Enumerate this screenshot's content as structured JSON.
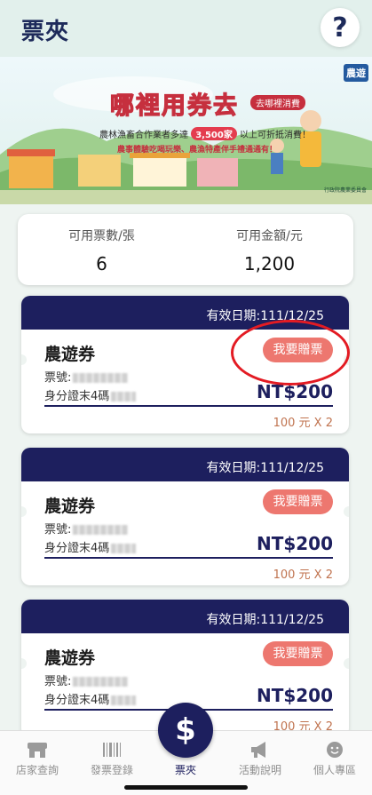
{
  "header": {
    "title": "票夾",
    "help_icon": "question-icon"
  },
  "banner": {
    "title": "哪裡用券去",
    "tag": "去哪裡消費",
    "line1_pre": "農林漁畜合作業者多達",
    "line1_highlight": "3,500家",
    "line1_post": "以上可折抵消費！",
    "line2": "農事體驗吃喝玩樂、農漁特產伴手禮通通有！",
    "corner_logo": "農遊",
    "footer": "行政院農業委員會"
  },
  "summary": {
    "tickets_label": "可用票數/張",
    "tickets_value": "6",
    "amount_label": "可用金額/元",
    "amount_value": "1,200"
  },
  "tickets": [
    {
      "expiry": "有效日期:111/12/25",
      "name": "農遊券",
      "no_label": "票號:",
      "id_label": "身分證末4碼",
      "gift_label": "我要贈票",
      "amount": "NT$200",
      "breakdown": "100 元 X 2"
    },
    {
      "expiry": "有效日期:111/12/25",
      "name": "農遊券",
      "no_label": "票號:",
      "id_label": "身分證末4碼",
      "gift_label": "我要贈票",
      "amount": "NT$200",
      "breakdown": "100 元 X 2"
    },
    {
      "expiry": "有效日期:111/12/25",
      "name": "農遊券",
      "no_label": "票號:",
      "id_label": "身分證末4碼",
      "gift_label": "我要贈票",
      "amount": "NT$200",
      "breakdown": "100 元 X 2"
    }
  ],
  "tabbar": {
    "items": [
      {
        "label": "店家查詢",
        "icon": "store-icon"
      },
      {
        "label": "發票登錄",
        "icon": "barcode-icon"
      },
      {
        "label": "票夾",
        "icon": "dollar-icon"
      },
      {
        "label": "活動說明",
        "icon": "megaphone-icon"
      },
      {
        "label": "個人專區",
        "icon": "smiley-icon"
      }
    ],
    "fab_symbol": "$"
  },
  "colors": {
    "navy": "#1d1f5e",
    "gift": "#ed776f",
    "annotation": "#e31b23"
  }
}
